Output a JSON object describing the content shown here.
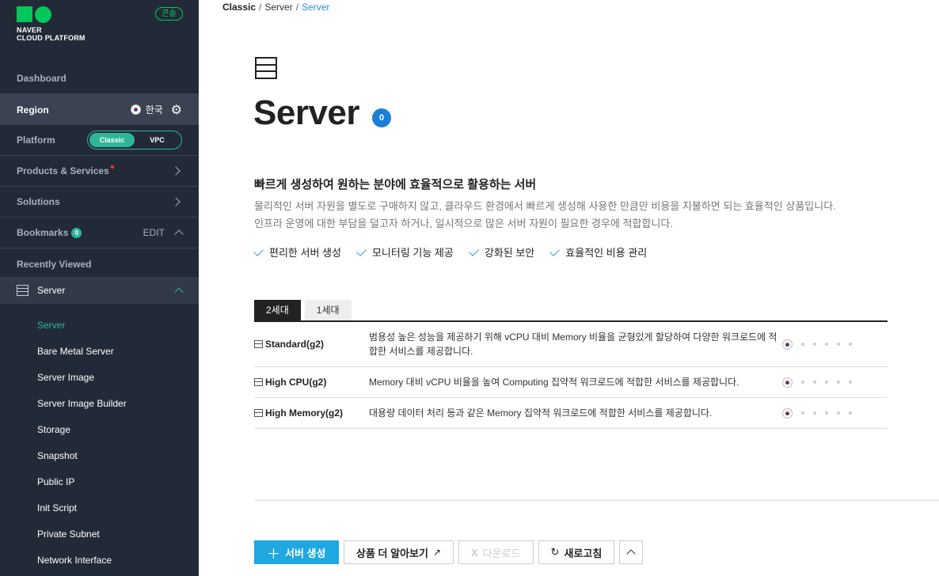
{
  "sidebar": {
    "logo_line1": "NAVER",
    "logo_line2": "CLOUD PLATFORM",
    "console_badge": "콘솔",
    "dashboard": "Dashboard",
    "region_label": "Region",
    "region_value": "한국",
    "platform_label": "Platform",
    "platform_options": [
      "Classic",
      "VPC"
    ],
    "platform_selected": "Classic",
    "products": "Products & Services",
    "solutions": "Solutions",
    "bookmarks": "Bookmarks",
    "bookmarks_count": "0",
    "edit": "EDIT",
    "recently_viewed": "Recently Viewed",
    "server_group": "Server",
    "sub_items": [
      "Server",
      "Bare Metal Server",
      "Server Image",
      "Server Image Builder",
      "Storage",
      "Snapshot",
      "Public IP",
      "Init Script",
      "Private Subnet",
      "Network Interface"
    ]
  },
  "breadcrumb": {
    "root": "Classic",
    "mid": "Server",
    "current": "Server"
  },
  "hero": {
    "title": "Server",
    "count": "0"
  },
  "description": {
    "title": "빠르게 생성하여 원하는 분야에 효율적으로 활용하는 서버",
    "line1": "물리적인 서버 자원을 별도로 구매하지 않고, 클라우드 환경에서 빠르게 생성해 사용한 만큼만 비용을 지불하면 되는 효율적인 상품입니다.",
    "line2": "인프라 운영에 대한 부담을 덜고자 하거나, 일시적으로 많은 서버 자원이 필요한 경우에 적합합니다."
  },
  "features": [
    "편리한 서버 생성",
    "모니터링 기능 제공",
    "강화된 보안",
    "효율적인 비용 관리"
  ],
  "tabs": [
    "2세대",
    "1세대"
  ],
  "rows": [
    {
      "name": "Standard(g2)",
      "desc": "범용성 높은 성능을 제공하기 위해 vCPU 대비 Memory 비율을 균형있게 할당하여 다양한 워크로드에 적합한 서비스를 제공합니다."
    },
    {
      "name": "High CPU(g2)",
      "desc": "Memory 대비 vCPU 비율을 높여 Computing 집약적 워크로드에 적합한 서비스를 제공합니다."
    },
    {
      "name": "High Memory(g2)",
      "desc": "대용량 데이터 처리 등과 같은 Memory 집약적 워크로드에 적합한 서비스를 제공합니다."
    }
  ],
  "buttons": {
    "create": "서버 생성",
    "learn_more": "상품 더 알아보기",
    "download": "다운로드",
    "refresh": "새로고침"
  },
  "colors": {
    "accent": "#2db79a",
    "primary": "#1ea7e1",
    "sidebar_bg": "#232a37"
  }
}
